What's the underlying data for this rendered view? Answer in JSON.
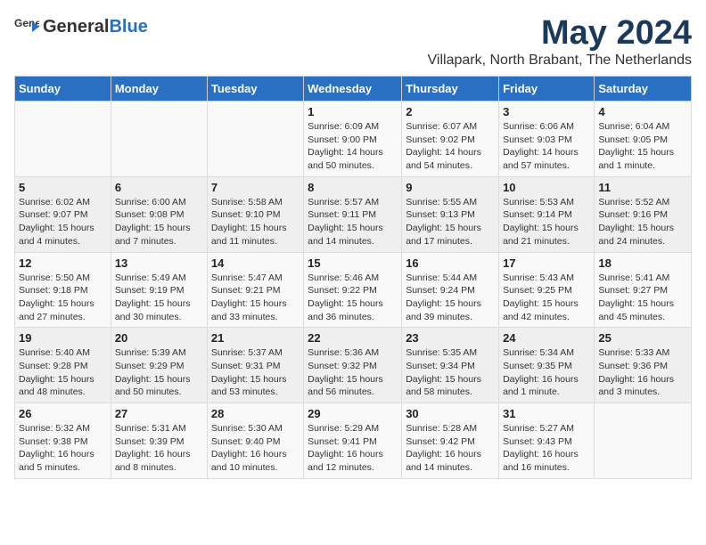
{
  "header": {
    "logo_general": "General",
    "logo_blue": "Blue",
    "month_year": "May 2024",
    "location": "Villapark, North Brabant, The Netherlands"
  },
  "weekdays": [
    "Sunday",
    "Monday",
    "Tuesday",
    "Wednesday",
    "Thursday",
    "Friday",
    "Saturday"
  ],
  "weeks": [
    [
      {
        "day": "",
        "sunrise": "",
        "sunset": "",
        "daylight": ""
      },
      {
        "day": "",
        "sunrise": "",
        "sunset": "",
        "daylight": ""
      },
      {
        "day": "",
        "sunrise": "",
        "sunset": "",
        "daylight": ""
      },
      {
        "day": "1",
        "sunrise": "Sunrise: 6:09 AM",
        "sunset": "Sunset: 9:00 PM",
        "daylight": "Daylight: 14 hours and 50 minutes."
      },
      {
        "day": "2",
        "sunrise": "Sunrise: 6:07 AM",
        "sunset": "Sunset: 9:02 PM",
        "daylight": "Daylight: 14 hours and 54 minutes."
      },
      {
        "day": "3",
        "sunrise": "Sunrise: 6:06 AM",
        "sunset": "Sunset: 9:03 PM",
        "daylight": "Daylight: 14 hours and 57 minutes."
      },
      {
        "day": "4",
        "sunrise": "Sunrise: 6:04 AM",
        "sunset": "Sunset: 9:05 PM",
        "daylight": "Daylight: 15 hours and 1 minute."
      }
    ],
    [
      {
        "day": "5",
        "sunrise": "Sunrise: 6:02 AM",
        "sunset": "Sunset: 9:07 PM",
        "daylight": "Daylight: 15 hours and 4 minutes."
      },
      {
        "day": "6",
        "sunrise": "Sunrise: 6:00 AM",
        "sunset": "Sunset: 9:08 PM",
        "daylight": "Daylight: 15 hours and 7 minutes."
      },
      {
        "day": "7",
        "sunrise": "Sunrise: 5:58 AM",
        "sunset": "Sunset: 9:10 PM",
        "daylight": "Daylight: 15 hours and 11 minutes."
      },
      {
        "day": "8",
        "sunrise": "Sunrise: 5:57 AM",
        "sunset": "Sunset: 9:11 PM",
        "daylight": "Daylight: 15 hours and 14 minutes."
      },
      {
        "day": "9",
        "sunrise": "Sunrise: 5:55 AM",
        "sunset": "Sunset: 9:13 PM",
        "daylight": "Daylight: 15 hours and 17 minutes."
      },
      {
        "day": "10",
        "sunrise": "Sunrise: 5:53 AM",
        "sunset": "Sunset: 9:14 PM",
        "daylight": "Daylight: 15 hours and 21 minutes."
      },
      {
        "day": "11",
        "sunrise": "Sunrise: 5:52 AM",
        "sunset": "Sunset: 9:16 PM",
        "daylight": "Daylight: 15 hours and 24 minutes."
      }
    ],
    [
      {
        "day": "12",
        "sunrise": "Sunrise: 5:50 AM",
        "sunset": "Sunset: 9:18 PM",
        "daylight": "Daylight: 15 hours and 27 minutes."
      },
      {
        "day": "13",
        "sunrise": "Sunrise: 5:49 AM",
        "sunset": "Sunset: 9:19 PM",
        "daylight": "Daylight: 15 hours and 30 minutes."
      },
      {
        "day": "14",
        "sunrise": "Sunrise: 5:47 AM",
        "sunset": "Sunset: 9:21 PM",
        "daylight": "Daylight: 15 hours and 33 minutes."
      },
      {
        "day": "15",
        "sunrise": "Sunrise: 5:46 AM",
        "sunset": "Sunset: 9:22 PM",
        "daylight": "Daylight: 15 hours and 36 minutes."
      },
      {
        "day": "16",
        "sunrise": "Sunrise: 5:44 AM",
        "sunset": "Sunset: 9:24 PM",
        "daylight": "Daylight: 15 hours and 39 minutes."
      },
      {
        "day": "17",
        "sunrise": "Sunrise: 5:43 AM",
        "sunset": "Sunset: 9:25 PM",
        "daylight": "Daylight: 15 hours and 42 minutes."
      },
      {
        "day": "18",
        "sunrise": "Sunrise: 5:41 AM",
        "sunset": "Sunset: 9:27 PM",
        "daylight": "Daylight: 15 hours and 45 minutes."
      }
    ],
    [
      {
        "day": "19",
        "sunrise": "Sunrise: 5:40 AM",
        "sunset": "Sunset: 9:28 PM",
        "daylight": "Daylight: 15 hours and 48 minutes."
      },
      {
        "day": "20",
        "sunrise": "Sunrise: 5:39 AM",
        "sunset": "Sunset: 9:29 PM",
        "daylight": "Daylight: 15 hours and 50 minutes."
      },
      {
        "day": "21",
        "sunrise": "Sunrise: 5:37 AM",
        "sunset": "Sunset: 9:31 PM",
        "daylight": "Daylight: 15 hours and 53 minutes."
      },
      {
        "day": "22",
        "sunrise": "Sunrise: 5:36 AM",
        "sunset": "Sunset: 9:32 PM",
        "daylight": "Daylight: 15 hours and 56 minutes."
      },
      {
        "day": "23",
        "sunrise": "Sunrise: 5:35 AM",
        "sunset": "Sunset: 9:34 PM",
        "daylight": "Daylight: 15 hours and 58 minutes."
      },
      {
        "day": "24",
        "sunrise": "Sunrise: 5:34 AM",
        "sunset": "Sunset: 9:35 PM",
        "daylight": "Daylight: 16 hours and 1 minute."
      },
      {
        "day": "25",
        "sunrise": "Sunrise: 5:33 AM",
        "sunset": "Sunset: 9:36 PM",
        "daylight": "Daylight: 16 hours and 3 minutes."
      }
    ],
    [
      {
        "day": "26",
        "sunrise": "Sunrise: 5:32 AM",
        "sunset": "Sunset: 9:38 PM",
        "daylight": "Daylight: 16 hours and 5 minutes."
      },
      {
        "day": "27",
        "sunrise": "Sunrise: 5:31 AM",
        "sunset": "Sunset: 9:39 PM",
        "daylight": "Daylight: 16 hours and 8 minutes."
      },
      {
        "day": "28",
        "sunrise": "Sunrise: 5:30 AM",
        "sunset": "Sunset: 9:40 PM",
        "daylight": "Daylight: 16 hours and 10 minutes."
      },
      {
        "day": "29",
        "sunrise": "Sunrise: 5:29 AM",
        "sunset": "Sunset: 9:41 PM",
        "daylight": "Daylight: 16 hours and 12 minutes."
      },
      {
        "day": "30",
        "sunrise": "Sunrise: 5:28 AM",
        "sunset": "Sunset: 9:42 PM",
        "daylight": "Daylight: 16 hours and 14 minutes."
      },
      {
        "day": "31",
        "sunrise": "Sunrise: 5:27 AM",
        "sunset": "Sunset: 9:43 PM",
        "daylight": "Daylight: 16 hours and 16 minutes."
      },
      {
        "day": "",
        "sunrise": "",
        "sunset": "",
        "daylight": ""
      }
    ]
  ]
}
